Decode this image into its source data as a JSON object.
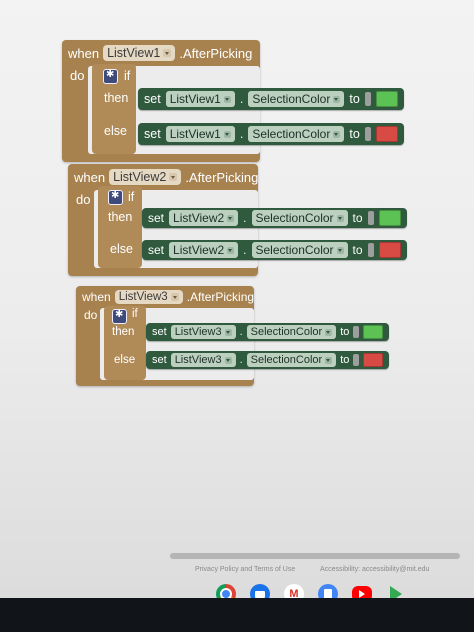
{
  "blocks": [
    {
      "component": "ListView1",
      "event_keyword": "when",
      "event_name": ".AfterPicking",
      "do_label": "do",
      "if_label": "if",
      "then_label": "then",
      "else_label": "else",
      "set_label": "set",
      "dot": ".",
      "property": "SelectionColor",
      "to_label": "to",
      "then_color": "#5dc254",
      "else_color": "#d84a44"
    },
    {
      "component": "ListView2",
      "event_keyword": "when",
      "event_name": ".AfterPicking",
      "do_label": "do",
      "if_label": "if",
      "then_label": "then",
      "else_label": "else",
      "set_label": "set",
      "dot": ".",
      "property": "SelectionColor",
      "to_label": "to",
      "then_color": "#5dc254",
      "else_color": "#d84a44"
    },
    {
      "component": "ListView3",
      "event_keyword": "when",
      "event_name": ".AfterPicking",
      "do_label": "do",
      "if_label": "if",
      "then_label": "then",
      "else_label": "else",
      "set_label": "set",
      "dot": ".",
      "property": "SelectionColor",
      "to_label": "to",
      "then_color": "#5dc254",
      "else_color": "#d84a44"
    }
  ],
  "footer": {
    "privacy": "Privacy Policy and Terms of Use",
    "accessibility": "Accessibility: accessibility@mit.edu"
  },
  "dock": {
    "icons": [
      "chrome-icon",
      "files-icon",
      "gmail-icon",
      "docs-icon",
      "youtube-icon",
      "play-store-icon"
    ]
  },
  "colors": {
    "event_block": "#a7824f",
    "set_block": "#2f5a3d",
    "background": "#ececec"
  }
}
